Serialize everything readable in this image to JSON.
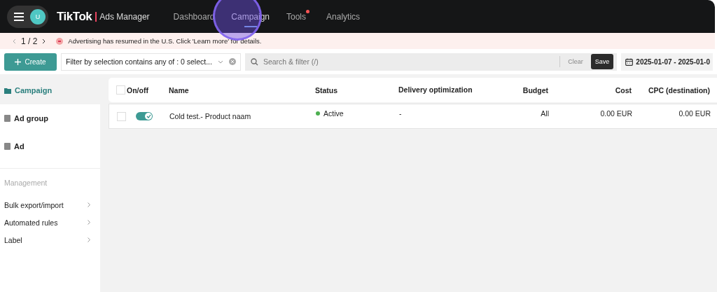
{
  "header": {
    "avatar": "U",
    "logo": "TikTok",
    "logo_suffix": "Ads Manager",
    "nav": [
      {
        "label": "Dashboard",
        "selected": false,
        "badge": false
      },
      {
        "label": "Campaign",
        "selected": true,
        "badge": false
      },
      {
        "label": "Tools",
        "selected": false,
        "badge": true
      },
      {
        "label": "Analytics",
        "selected": false,
        "badge": false
      }
    ],
    "click_highlight": true
  },
  "banner": {
    "pager": "1 / 2",
    "message": "Advertising has resumed in the U.S. Click 'Learn more' for details."
  },
  "toolbar": {
    "create": "Create",
    "filter": "Filter by selection contains any of : 0 select...",
    "search_placeholder": "Search & filter (/)",
    "clear": "Clear",
    "save": "Save",
    "date_range": "2025-01-07 - 2025-01-0"
  },
  "sidebar": {
    "levels": [
      {
        "label": "Campaign",
        "selected": true
      },
      {
        "label": "Ad group",
        "selected": false
      },
      {
        "label": "Ad",
        "selected": false
      }
    ],
    "section": "Management",
    "items": [
      "Bulk export/import",
      "Automated rules",
      "Label"
    ]
  },
  "table": {
    "all_checked": false,
    "columns": [
      "On/off",
      "Name",
      "Status",
      "Delivery optimization",
      "Budget",
      "Cost",
      "CPC (destination)"
    ],
    "rows": [
      {
        "checked": false,
        "on": true,
        "name": "Cold test.- Product naam",
        "status": "Active",
        "color": "#4caf50",
        "delivery": "-",
        "budget": "All",
        "cost": "0.00 EUR",
        "cpc": "0.00 EUR"
      }
    ]
  }
}
